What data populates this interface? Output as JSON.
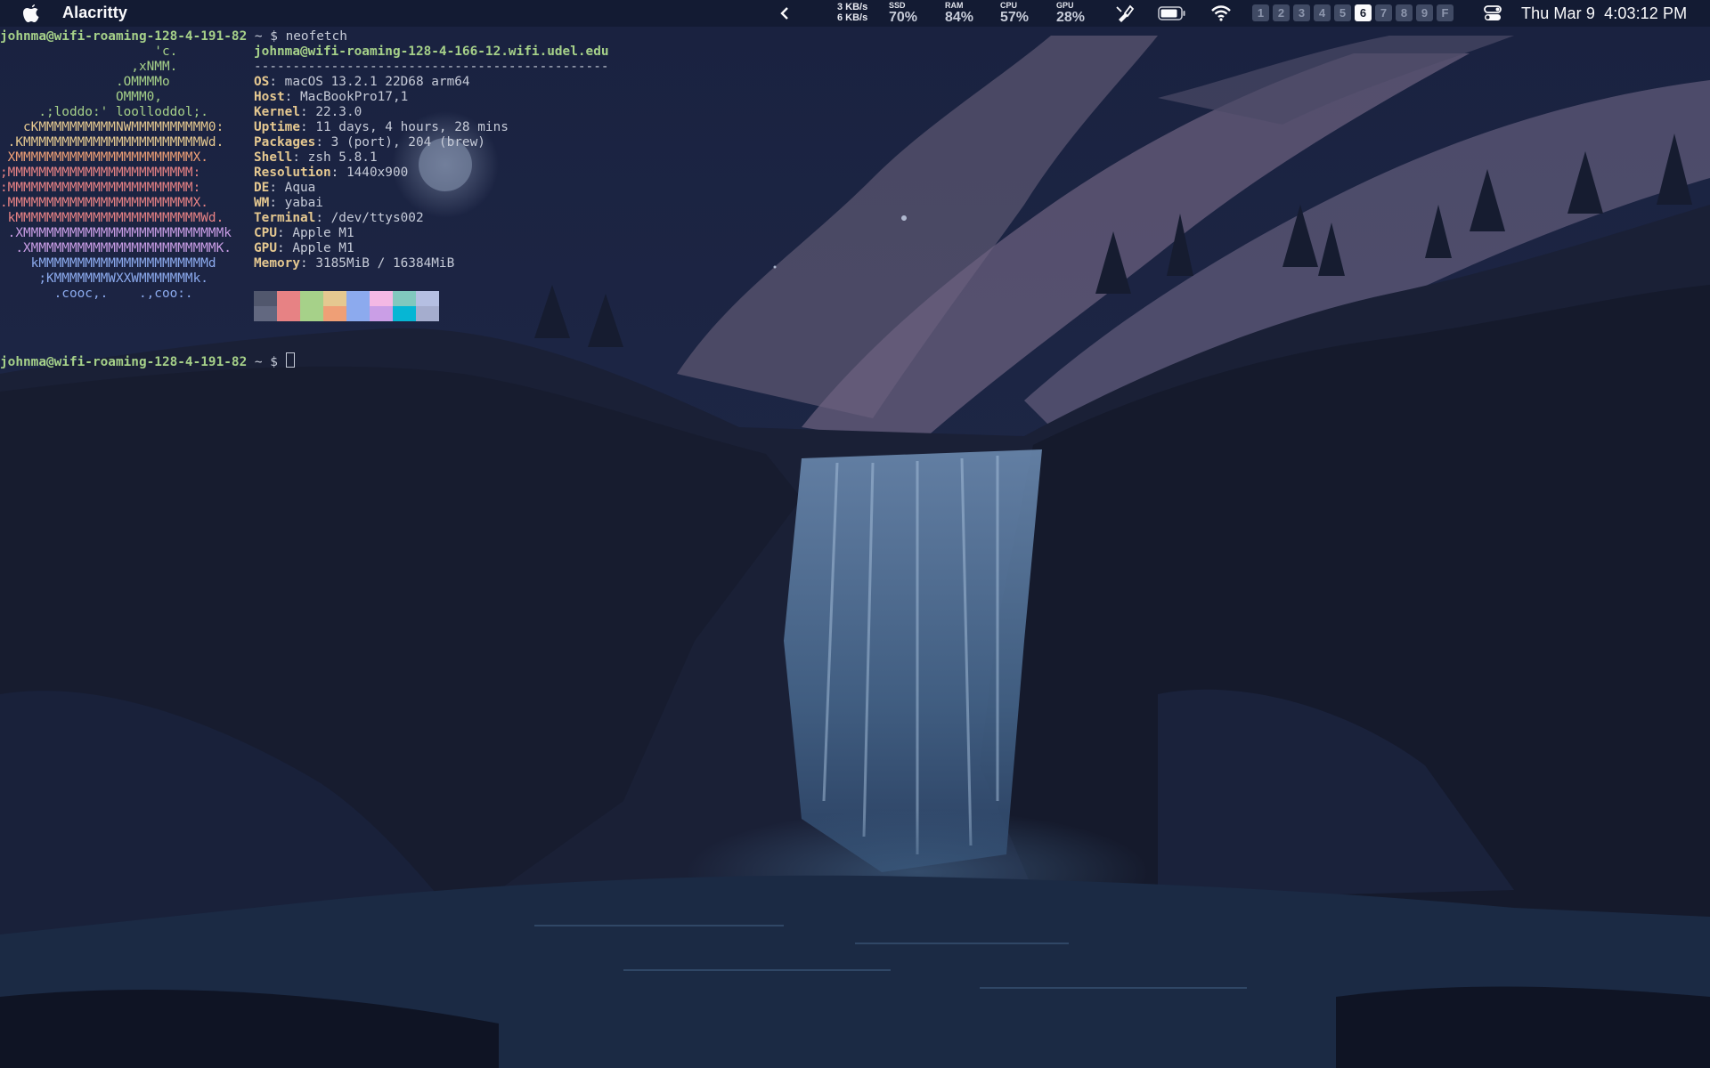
{
  "menubar": {
    "app_name": "Alacritty",
    "icons": [
      "apple-icon",
      "chevron-left-icon",
      "battery-icon",
      "wifi-icon",
      "control-center-icon",
      "brush-icon"
    ],
    "net": {
      "up": "3 KB/s",
      "down": "6 KB/s"
    },
    "stats": [
      {
        "label": "SSD",
        "value": "70%"
      },
      {
        "label": "RAM",
        "value": "84%"
      },
      {
        "label": "CPU",
        "value": "57%"
      },
      {
        "label": "GPU",
        "value": "28%"
      }
    ],
    "spaces": [
      "1",
      "2",
      "3",
      "4",
      "5",
      "6",
      "7",
      "8",
      "9",
      "F"
    ],
    "active_space": "6",
    "date": "Thu Mar 9",
    "time": "4:03:12 PM"
  },
  "terminal": {
    "prompt_host": "johnma@wifi-roaming-128-4-191-82",
    "prompt_path": " ~ $ ",
    "command": "neofetch",
    "title": "johnma@wifi-roaming-128-4-166-12.wifi.udel.edu",
    "separator": "----------------------------------------------",
    "info": [
      {
        "key": "OS",
        "value": "macOS 13.2.1 22D68 arm64"
      },
      {
        "key": "Host",
        "value": "MacBookPro17,1"
      },
      {
        "key": "Kernel",
        "value": "22.3.0"
      },
      {
        "key": "Uptime",
        "value": "11 days, 4 hours, 28 mins"
      },
      {
        "key": "Packages",
        "value": "3 (port), 204 (brew)"
      },
      {
        "key": "Shell",
        "value": "zsh 5.8.1"
      },
      {
        "key": "Resolution",
        "value": "1440x900"
      },
      {
        "key": "DE",
        "value": "Aqua"
      },
      {
        "key": "WM",
        "value": "yabai"
      },
      {
        "key": "Terminal",
        "value": "/dev/ttys002"
      },
      {
        "key": "CPU",
        "value": "Apple M1"
      },
      {
        "key": "GPU",
        "value": "Apple M1"
      },
      {
        "key": "Memory",
        "value": "3185MiB / 16384MiB"
      }
    ],
    "ascii_art": [
      "                    'c.",
      "                 ,xNMM.",
      "               .OMMMMo",
      "               OMMM0,",
      "     .;loddo:' loolloddol;.",
      "   cKMMMMMMMMMMNWMMMMMMMMMM0:",
      " .KMMMMMMMMMMMMMMMMMMMMMMMWd.",
      " XMMMMMMMMMMMMMMMMMMMMMMMX.",
      ";MMMMMMMMMMMMMMMMMMMMMMMM:",
      ":MMMMMMMMMMMMMMMMMMMMMMMM:",
      ".MMMMMMMMMMMMMMMMMMMMMMMMX.",
      " kMMMMMMMMMMMMMMMMMMMMMMMMWd.",
      " .XMMMMMMMMMMMMMMMMMMMMMMMMMMk",
      "  .XMMMMMMMMMMMMMMMMMMMMMMMMK.",
      "    kMMMMMMMMMMMMMMMMMMMMMMd",
      "     ;KMMMMMMMWXXWMMMMMMMk.",
      "       .cooc,.    .,coo:."
    ],
    "palette_top": [
      "#51576d",
      "#e78284",
      "#a6d189",
      "#e5c890",
      "#8caaee",
      "#f4b8e4",
      "#81c8be",
      "#b5bfe2"
    ],
    "palette_bottom": [
      "#626880",
      "#e78284",
      "#a6d189",
      "#ef9f76",
      "#8caaee",
      "#ca9ee6",
      "#06b6d4",
      "#a5adce"
    ]
  }
}
